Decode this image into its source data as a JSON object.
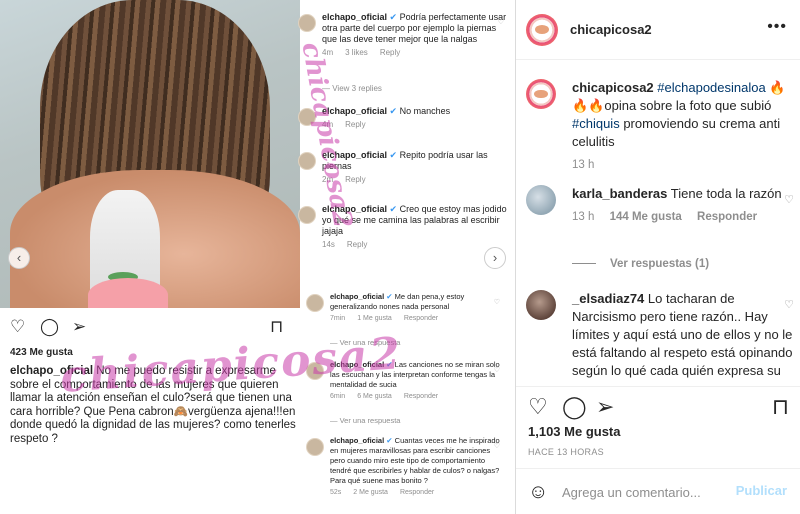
{
  "image": {
    "comments": [
      {
        "user": "elchapo_oficial",
        "text": "Podría perfectamente usar otra parte del cuerpo por ejemplo la piernas que las deve tener mejor que la nalgas",
        "time": "4m",
        "likes": "3 likes",
        "reply": "Reply"
      },
      {
        "view_replies": "View 3 replies"
      },
      {
        "user": "elchapo_oficial",
        "text": "No manches",
        "time": "4m",
        "reply": "Reply"
      },
      {
        "user": "elchapo_oficial",
        "text": "Repito podría usar las piernas",
        "time": "2m",
        "reply": "Reply"
      },
      {
        "user": "elchapo_oficial",
        "text": "Creo que estoy mas jodido yo qué se me camina las palabras al escribir jajaja",
        "time": "14s",
        "reply": "Reply"
      },
      {
        "user": "elchapo_oficial",
        "text": "Me dan pena,y estoy generalizando nones nada personal",
        "time": "7min",
        "likes": "1 Me gusta",
        "reply": "Responder"
      },
      {
        "view_reply": "Ver una respuesta"
      },
      {
        "user": "elchapo_oficial",
        "text": "Las canciones no se miran solo las escuchan y las interpretan conforme tengas la mentalidad de sucia",
        "time": "6min",
        "likes": "6 Me gusta",
        "reply": "Responder"
      },
      {
        "view_reply": "Ver una respuesta"
      },
      {
        "user": "elchapo_oficial",
        "text": "Cuantas veces me he inspirado en mujeres maravillosas para escribir canciones pero cuando miro este tipo de comportamiento tendré que escribirles y hablar de culos? o nalgas? Para qué suene mas bonito ?",
        "time": "52s",
        "likes": "2 Me gusta",
        "reply": "Responder"
      }
    ],
    "likes": "423 Me gusta",
    "caption_user": "elchapo_oficial",
    "caption_text": "No me puedo resistir a expresarme sobre el comportamiento de las mujeres que quieren llamar la atención enseñan el culo?será que tienen una cara horrible? Que Pena cabron🙈vergüenza ajena!!!en donde quedó la dignidad de las mujeres? como tenerles respeto ?",
    "watermark": "chicapicosa2",
    "colors": {
      "watermark": "#c83caa"
    }
  },
  "sidebar": {
    "username": "chicapicosa2",
    "post": {
      "user": "chicapicosa2",
      "hashtag1": "#elchapodesinaloa",
      "text_a": " 🔥🔥🔥opina sobre la foto que subió ",
      "hashtag2": "#chiquis",
      "text_b": " promoviendo su crema anti celulitis",
      "time": "13 h"
    },
    "comments": [
      {
        "user": "karla_banderas",
        "text": "Tiene toda la razón",
        "time": "13 h",
        "likes": "144 Me gusta",
        "reply": "Responder",
        "view_replies": "Ver respuestas (1)"
      },
      {
        "user": "_elsadiaz74",
        "text": "Lo tacharan de Narcisismo pero tiene razón.. Hay límites y aquí está uno de ellos y no le está faltando al respeto está opinando según lo qué cada quién expresa su"
      }
    ],
    "likes": "1,103 Me gusta",
    "timestamp": "HACE 13 HORAS",
    "comment_placeholder": "Agrega un comentario...",
    "publish_label": "Publicar",
    "icons": [
      "heart-icon",
      "comment-icon",
      "share-icon",
      "bookmark-icon",
      "emoji-icon",
      "more-icon"
    ],
    "colors": {
      "link": "#00376b",
      "muted": "#8e8e8e",
      "publish": "#b2dffc"
    }
  }
}
